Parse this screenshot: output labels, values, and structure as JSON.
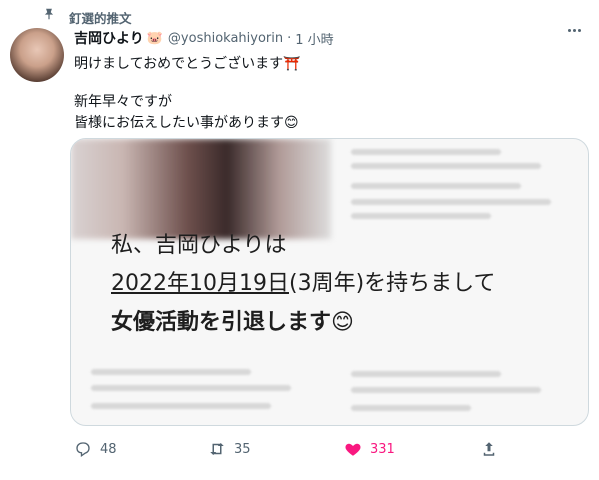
{
  "pinned": {
    "label": "釘選的推文"
  },
  "tweet": {
    "author_name": "吉岡ひより",
    "author_emoji": "🐷",
    "handle": "@yoshiokahiyorin",
    "separator": "·",
    "time": "1 小時",
    "lines": [
      "明けましておめでとうございます⛩️",
      "新年早々ですが",
      "皆様にお伝えしたい事があります😊"
    ]
  },
  "card": {
    "line1": "私、吉岡ひよりは",
    "line2_underlined": "2022年10月19日",
    "line2_rest": "(3周年)を持ちまして",
    "line3": "女優活動を引退します😊"
  },
  "actions": {
    "reply_count": "48",
    "retweet_count": "35",
    "like_count": "331"
  },
  "colors": {
    "like": "#f91880",
    "muted": "#536471",
    "text": "#0f1419"
  },
  "icons": [
    "pin-icon",
    "more-icon",
    "reply-icon",
    "retweet-icon",
    "heart-icon",
    "share-icon"
  ]
}
